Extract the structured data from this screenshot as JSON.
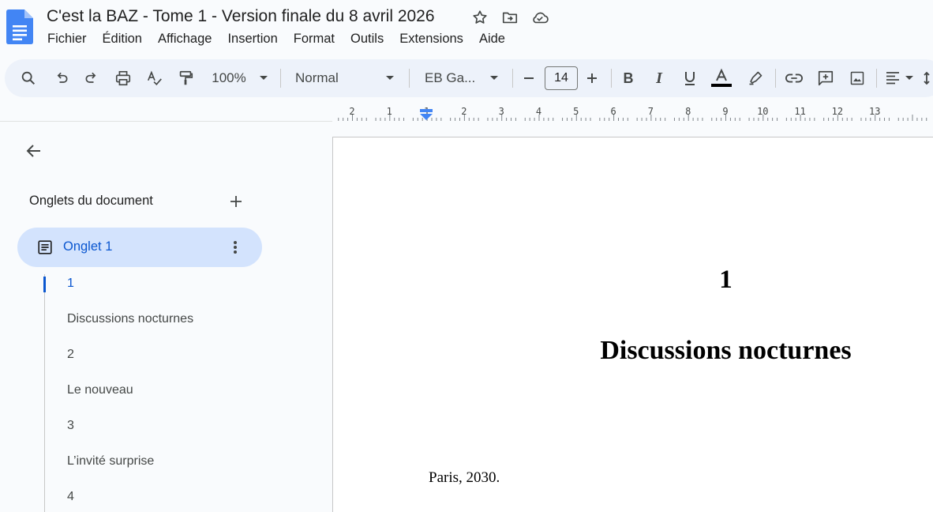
{
  "app": {
    "title": "C'est la BAZ - Tome 1 - Version finale du 8 avril 2026",
    "icons": [
      "docs-logo-icon",
      "star-icon",
      "move-to-folder-icon",
      "cloud-saved-icon"
    ]
  },
  "menu": [
    "Fichier",
    "Édition",
    "Affichage",
    "Insertion",
    "Format",
    "Outils",
    "Extensions",
    "Aide"
  ],
  "toolbar": {
    "zoom": "100%",
    "style": "Normal",
    "font": "EB Ga...",
    "font_size": "14",
    "text_color": "#000000",
    "accent": "#0b57d0",
    "icons": [
      "search-icon",
      "undo-icon",
      "redo-icon",
      "print-icon",
      "spellcheck-icon",
      "paint-format-icon",
      "minus-icon",
      "plus-icon",
      "bold-icon",
      "italic-icon",
      "underline-icon",
      "text-color-icon",
      "highlight-icon",
      "link-icon",
      "comment-icon",
      "image-icon",
      "align-left-icon",
      "line-spacing-icon"
    ]
  },
  "ruler": {
    "labels": [
      "2",
      "1",
      "1",
      "2",
      "3",
      "4",
      "5",
      "6",
      "7",
      "8",
      "9",
      "10",
      "11",
      "12",
      "13"
    ]
  },
  "sidebar": {
    "heading": "Onglets du document",
    "tab": {
      "label": "Onglet 1"
    },
    "outline": [
      {
        "label": "1",
        "active": true
      },
      {
        "label": "Discussions nocturnes"
      },
      {
        "label": "2"
      },
      {
        "label": "Le nouveau"
      },
      {
        "label": "3"
      },
      {
        "label": "L’invité surprise"
      },
      {
        "label": "4"
      }
    ]
  },
  "document": {
    "chapter_number": "1",
    "chapter_title": "Discussions nocturnes",
    "first_line": "Paris, 2030."
  }
}
